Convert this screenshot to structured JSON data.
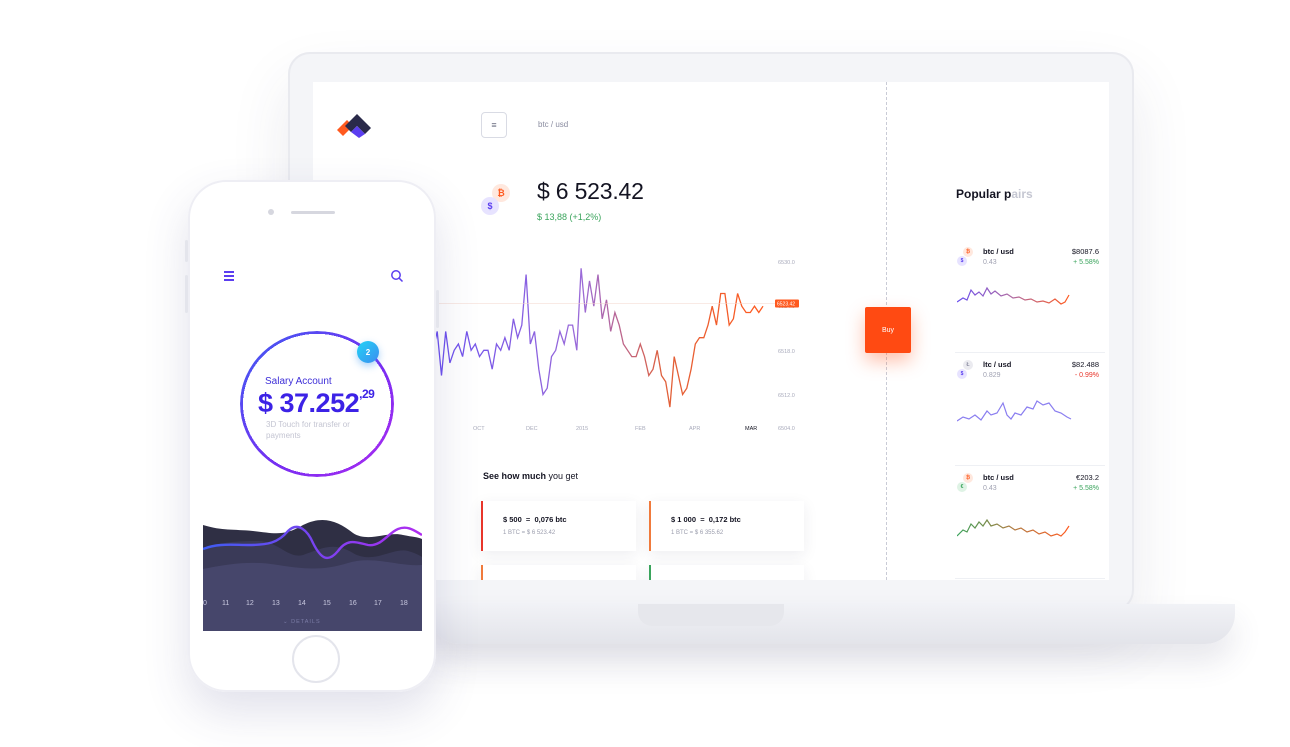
{
  "desktop": {
    "pair_label": "btc / usd",
    "price": "$ 6 523.42",
    "price_change": "$ 13,88 (+1,2%)",
    "buy_label": "Buy",
    "coins": {
      "top": "₿",
      "bottom": "$"
    },
    "popular_title_visible": "Popular p",
    "popular_title_faded": "airs",
    "see_title_bold": "See how much",
    "see_title_rest": "you get",
    "conversions": [
      {
        "main": "$ 500  =  0,076 btc",
        "sub": "1 BTC = $ 6 523.42",
        "color": "#e8352a"
      },
      {
        "main": "$ 1 000  =  0,172 btc",
        "sub": "1 BTC = $ 6 355.62",
        "color": "#f07a3c"
      }
    ],
    "pairs": [
      {
        "name": "btc / usd",
        "sub": "0.43",
        "value": "$8087.6",
        "change": "+ 5.58%",
        "change_color": "#3aa45c",
        "coin_top": "₿",
        "coin_bottom": "$"
      },
      {
        "name": "ltc / usd",
        "sub": "0.829",
        "value": "$82.488",
        "change": "- 0.99%",
        "change_color": "#e8352a",
        "coin_top": "Ł",
        "coin_bottom": "$"
      },
      {
        "name": "btc / usd",
        "sub": "0.43",
        "value": "€203.2",
        "change": "+ 5.58%",
        "change_color": "#3aa45c",
        "coin_top": "₿",
        "coin_bottom": "€"
      }
    ]
  },
  "chart_data": {
    "type": "line",
    "x_ticks": [
      "OCT",
      "DEC",
      "2015",
      "FEB",
      "APR",
      "MAR"
    ],
    "y_ticks": [
      "6530.0",
      "6524.0",
      "6518.0",
      "6512.0",
      "6504.0"
    ],
    "current_label": "6523.42",
    "series": [
      {
        "values": [
          6516,
          6519,
          6512,
          6519,
          6514,
          6516,
          6517,
          6515,
          6519,
          6516,
          6517,
          6515,
          6516,
          6516,
          6513,
          6517,
          6516,
          6518,
          6516,
          6521,
          6518,
          6520,
          6528,
          6517,
          6519,
          6513,
          6509,
          6510,
          6515,
          6516,
          6519,
          6517,
          6520,
          6520,
          6516,
          6529,
          6522,
          6527,
          6523,
          6528,
          6521,
          6524,
          6519,
          6522,
          6520,
          6517,
          6516,
          6515,
          6515,
          6517,
          6515,
          6512,
          6513,
          6516,
          6512,
          6511,
          6507,
          6515,
          6512,
          6509,
          6510,
          6513,
          6517,
          6518,
          6518,
          6520,
          6523,
          6520,
          6525,
          6525,
          6520,
          6521,
          6525,
          6523,
          6522,
          6522,
          6523,
          6522,
          6523
        ]
      }
    ]
  },
  "phone": {
    "account_label": "Salary Account",
    "amount": "$ 37.252",
    "amount_cents": ",29",
    "hint": "3D Touch for transfer or payments",
    "badge": "2",
    "days": [
      "0",
      "11",
      "12",
      "13",
      "14",
      "15",
      "16",
      "17",
      "18"
    ],
    "details": "DETAILS"
  },
  "colors": {
    "accent": "#ff4a12",
    "purple": "#5b3ef0",
    "positive": "#3aa45c",
    "negative": "#e8352a"
  }
}
